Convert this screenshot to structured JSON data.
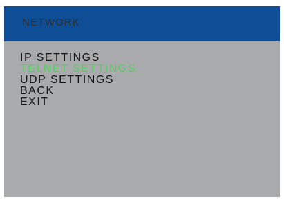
{
  "header": {
    "title": "NETWORK"
  },
  "menu": {
    "items": [
      {
        "label": "IP SETTINGS",
        "selected": false
      },
      {
        "label": "TELNET SETTINGS",
        "selected": true
      },
      {
        "label": "UDP SETTINGS",
        "selected": false
      },
      {
        "label": "BACK",
        "selected": false
      },
      {
        "label": "EXIT",
        "selected": false
      }
    ]
  },
  "colors": {
    "header_background": "#0d4e96",
    "panel_background": "#a9aaac",
    "text": "#141414",
    "selected_text": "#4fd25a"
  }
}
